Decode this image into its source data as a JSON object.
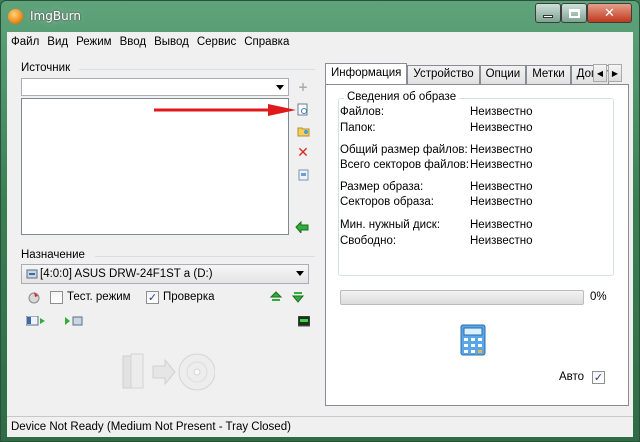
{
  "window": {
    "title": "ImgBurn"
  },
  "menu": [
    "Файл",
    "Вид",
    "Режим",
    "Ввод",
    "Вывод",
    "Сервис",
    "Справка"
  ],
  "source": {
    "label": "Источник",
    "combo_value": ""
  },
  "destination": {
    "label": "Назначение",
    "drive": "[4:0:0] ASUS DRW-24F1ST   a (D:)"
  },
  "options": {
    "test_mode": {
      "label": "Тест. режим",
      "checked": false
    },
    "verify": {
      "label": "Проверка",
      "checked": true,
      "mark": "✓"
    }
  },
  "tabs": [
    "Информация",
    "Устройство",
    "Опции",
    "Метки",
    "Дополн"
  ],
  "active_tab": "Информация",
  "info": {
    "group_title": "Сведения об образе",
    "rows": [
      {
        "label": "Файлов:",
        "value": "Неизвестно"
      },
      {
        "label": "Папок:",
        "value": "Неизвестно"
      },
      {
        "label": "Общий размер файлов:",
        "value": "Неизвестно"
      },
      {
        "label": "Всего секторов файлов:",
        "value": "Неизвестно"
      },
      {
        "label": "Размер образа:",
        "value": "Неизвестно"
      },
      {
        "label": "Секторов образа:",
        "value": "Неизвестно"
      },
      {
        "label": "Мин. нужный диск:",
        "value": "Неизвестно"
      },
      {
        "label": "Свободно:",
        "value": "Неизвестно"
      }
    ],
    "progress_text": "0%",
    "progress_value": 0,
    "auto": {
      "label": "Авто",
      "checked": true,
      "mark": "✓"
    }
  },
  "status_bar": "Device Not Ready (Medium Not Present - Tray Closed)",
  "colors": {
    "arrow": "#e0191b",
    "window_green": "#3b8053",
    "accent": "#2a3c86"
  },
  "icons": [
    "add-file-icon",
    "browse-folder-icon",
    "add-folder-icon",
    "remove-icon",
    "clear-list-icon",
    "calculate-icon",
    "drive-icon",
    "erase-disc-icon",
    "eject-icon",
    "load-icon",
    "log-icon",
    "play-icon",
    "write-icon",
    "calculator-icon",
    "build-button-icon"
  ]
}
